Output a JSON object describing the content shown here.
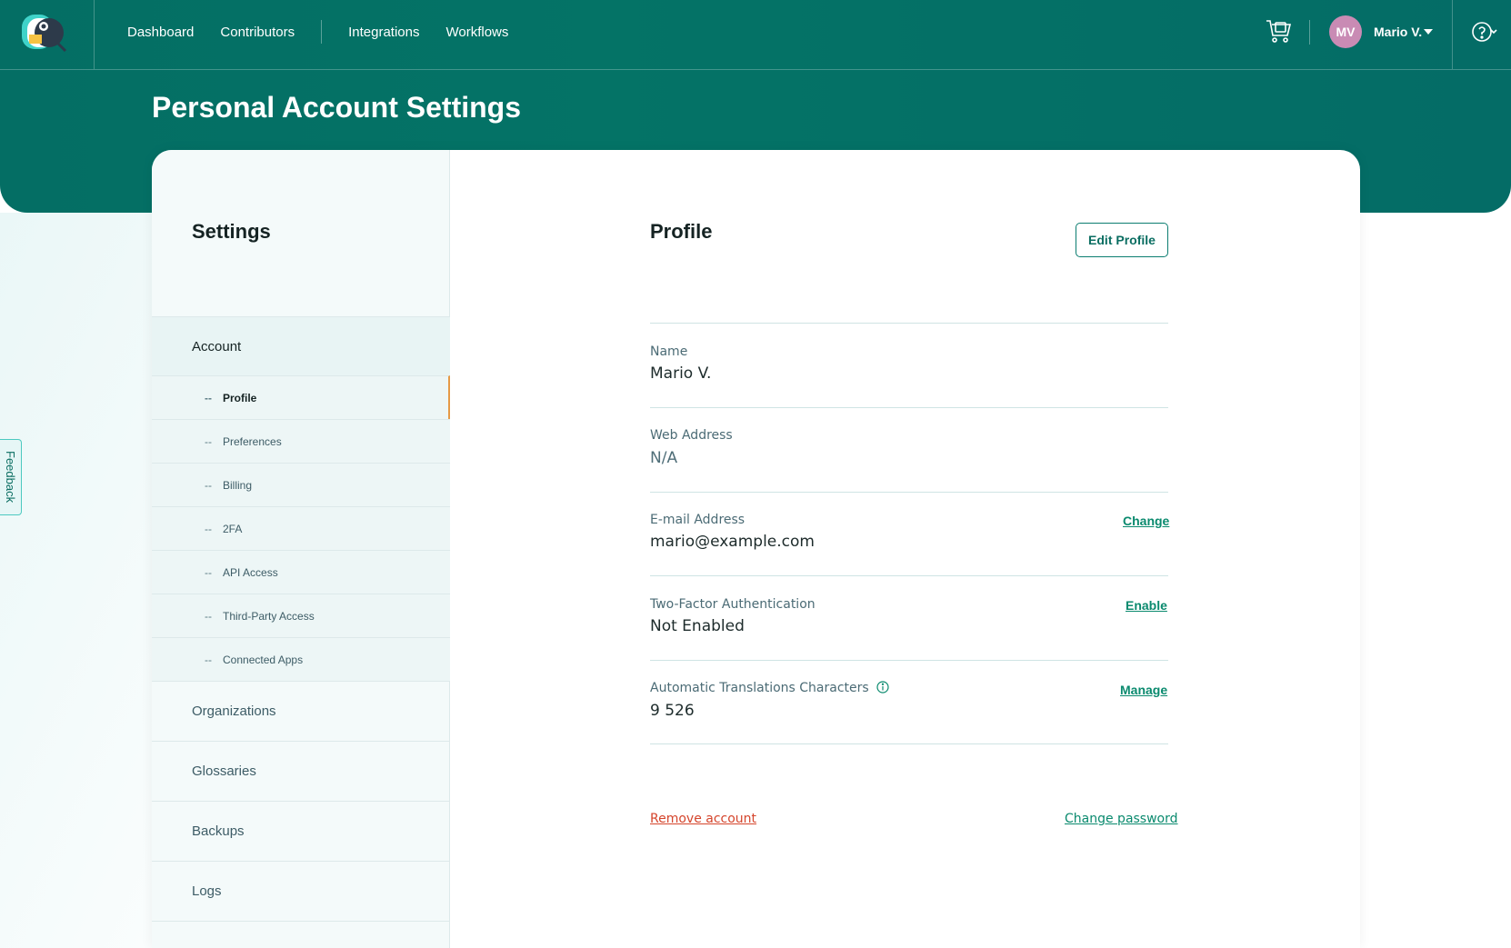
{
  "nav": {
    "links": [
      "Dashboard",
      "Contributors",
      "Integrations",
      "Workflows"
    ],
    "user": {
      "initials": "MV",
      "name": "Mario V."
    }
  },
  "page": {
    "title": "Personal Account Settings"
  },
  "sidebar": {
    "title": "Settings",
    "account_label": "Account",
    "sub_items": [
      "Profile",
      "Preferences",
      "Billing",
      "2FA",
      "API Access",
      "Third-Party Access",
      "Connected Apps"
    ],
    "sections": [
      "Organizations",
      "Glossaries",
      "Backups",
      "Logs"
    ]
  },
  "profile": {
    "title": "Profile",
    "edit_button": "Edit Profile",
    "fields": [
      {
        "label": "Name",
        "value": "Mario V.",
        "action": ""
      },
      {
        "label": "Web Address",
        "value": "N/A",
        "action": ""
      },
      {
        "label": "E-mail Address",
        "value": "mario@example.com",
        "action": "Change"
      },
      {
        "label": "Two-Factor Authentication",
        "value": "Not Enabled",
        "action": "Enable"
      },
      {
        "label": "Automatic Translations Characters",
        "value": "9 526",
        "action": "Manage"
      }
    ],
    "remove_account": "Remove account",
    "change_password": "Change password"
  },
  "feedback": {
    "label": "Feedback"
  },
  "colors": {
    "header": "#046e64",
    "accent": "#0a8a6e",
    "danger": "#d5452c",
    "active_marker": "#e69a46"
  }
}
